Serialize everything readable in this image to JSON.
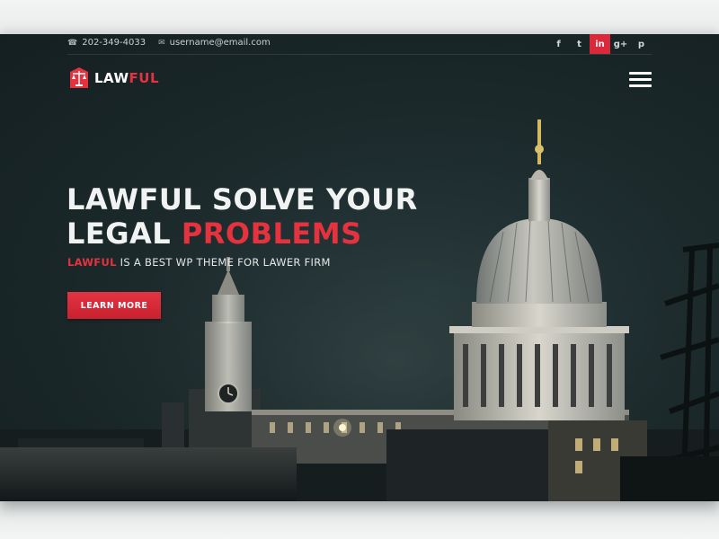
{
  "topbar": {
    "phone": "202-349-4033",
    "email": "username@email.com",
    "phone_icon": "phone-icon",
    "email_icon": "envelope-icon",
    "social": [
      {
        "icon": "facebook-icon",
        "glyph": "f"
      },
      {
        "icon": "twitter-icon",
        "glyph": "t"
      },
      {
        "icon": "linkedin-icon",
        "glyph": "in",
        "active": true
      },
      {
        "icon": "google-plus-icon",
        "glyph": "g+"
      },
      {
        "icon": "pinterest-icon",
        "glyph": "p"
      }
    ]
  },
  "logo": {
    "part1": "LAW",
    "part2": "FUL",
    "icon": "scales-of-justice-icon"
  },
  "nav": {
    "menu_icon": "hamburger-menu-icon"
  },
  "hero": {
    "line1": "LAWFUL SOLVE YOUR",
    "line2_plain": "LEGAL ",
    "line2_highlight": "PROBLEMS",
    "tagline_brand": "LAWFUL",
    "tagline_rest": " IS A BEST WP THEME FOR LAWER FIRM",
    "cta_label": "LEARN MORE"
  },
  "colors": {
    "accent": "#e4323f",
    "background": "#1c2a2c",
    "text": "#f1f3f3"
  }
}
